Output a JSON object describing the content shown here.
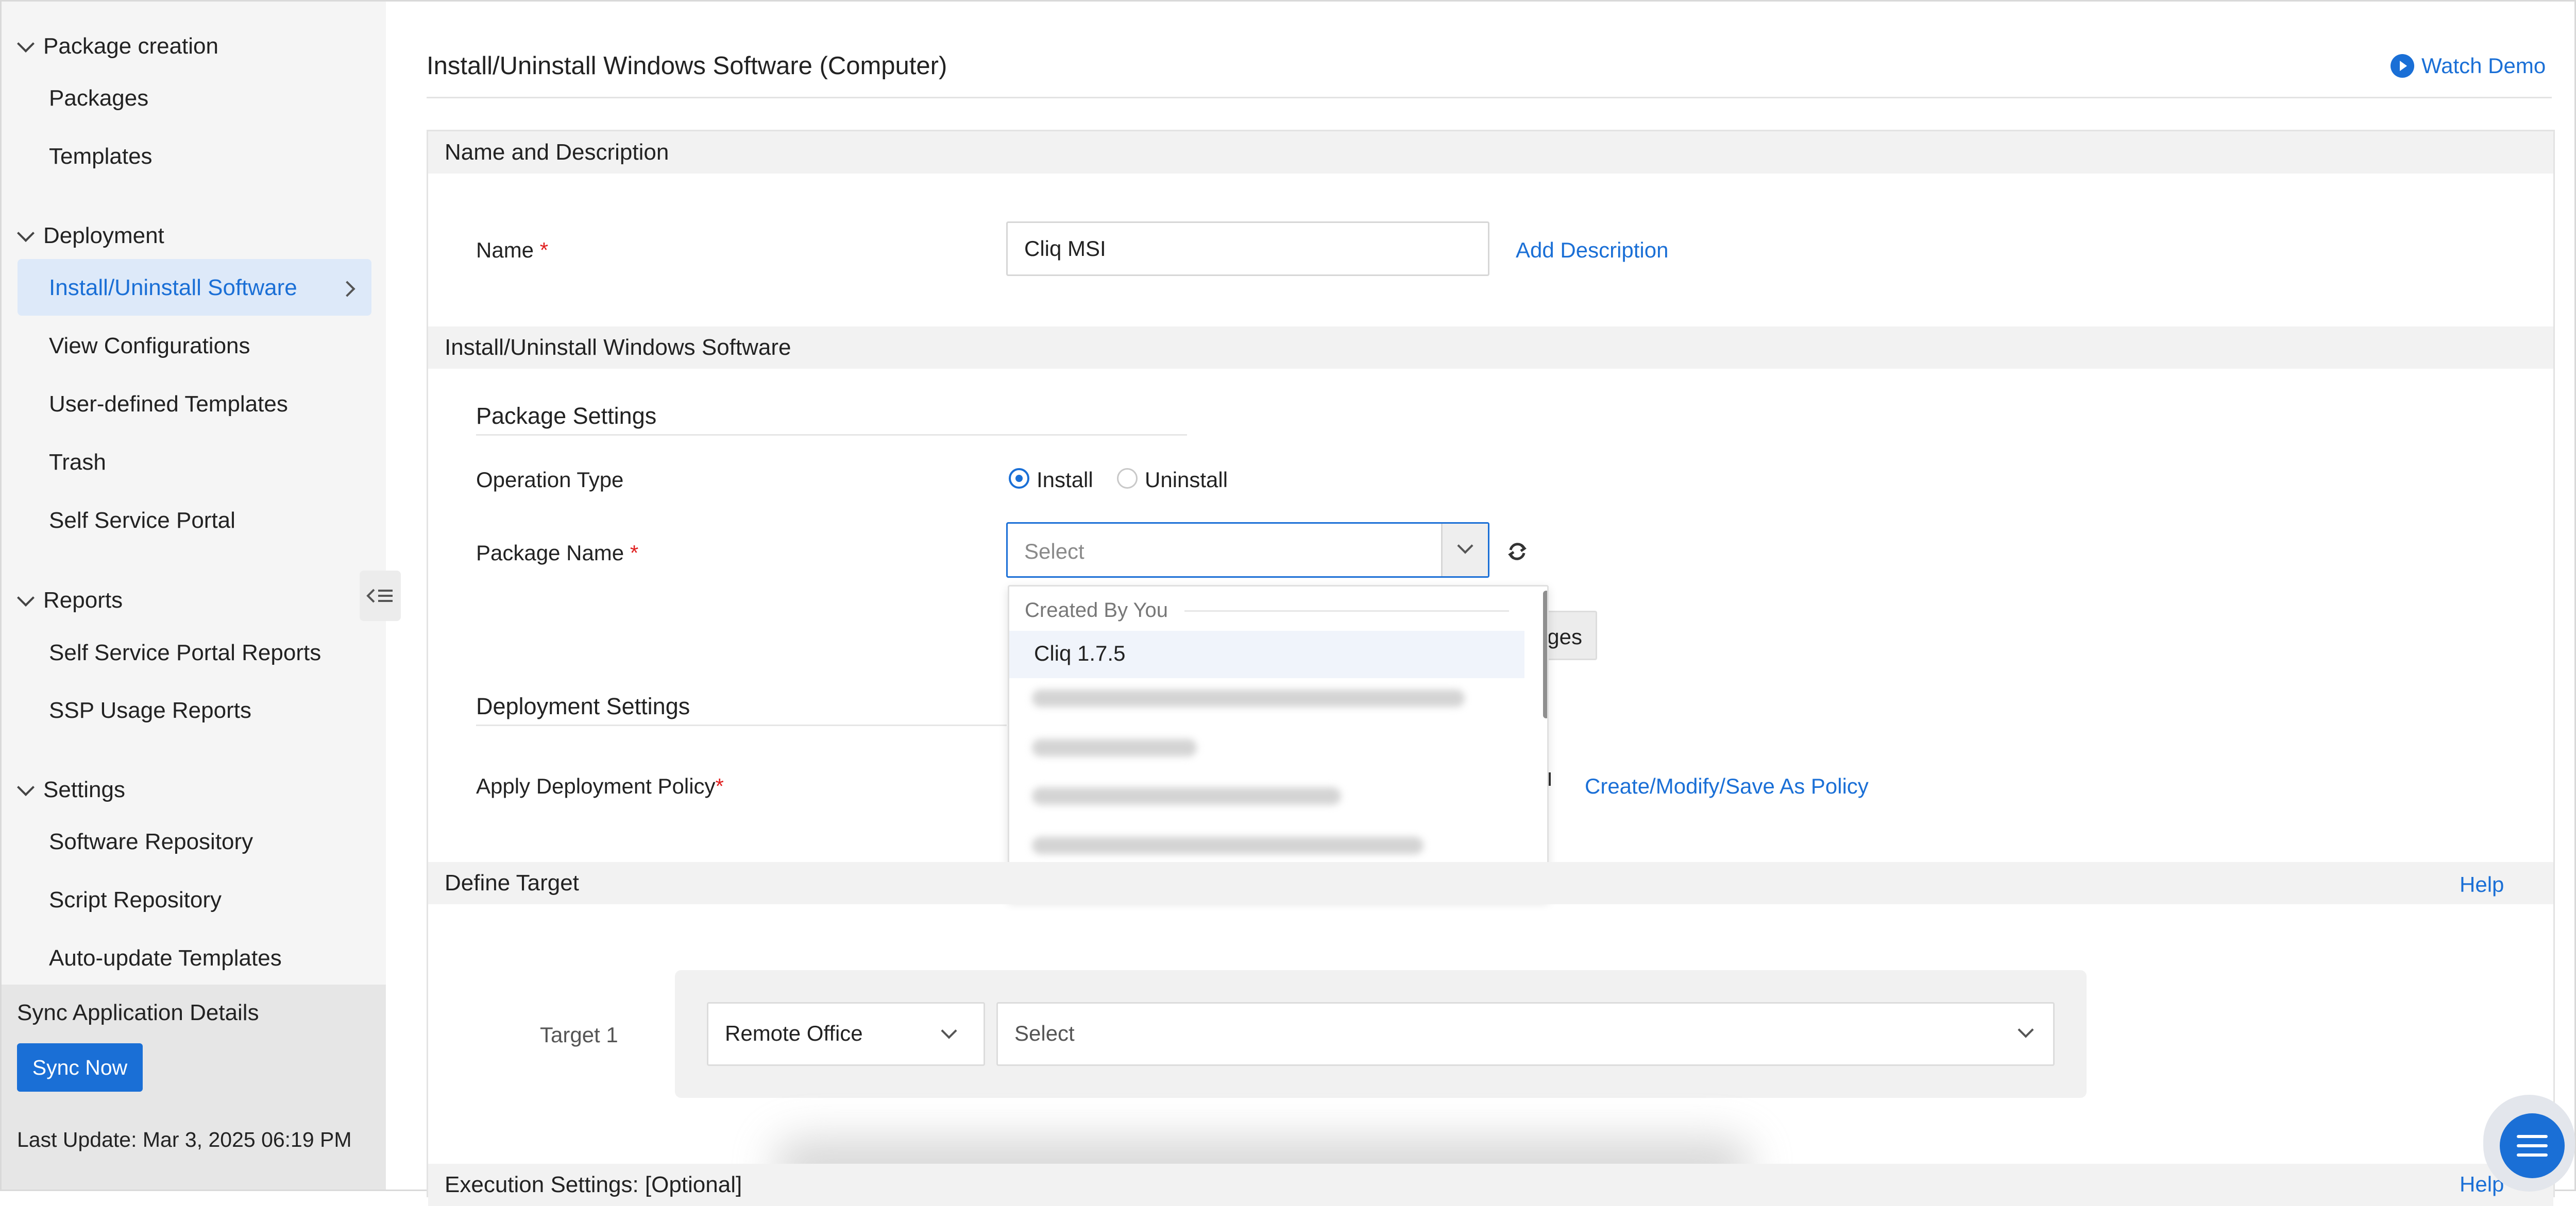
{
  "sidebar": {
    "sections": [
      {
        "title": "Package creation",
        "items": [
          "Packages",
          "Templates"
        ]
      },
      {
        "title": "Deployment",
        "items": [
          "Install/Uninstall Software",
          "View Configurations",
          "User-defined Templates",
          "Trash",
          "Self Service Portal"
        ]
      },
      {
        "title": "Reports",
        "items": [
          "Self Service Portal Reports",
          "SSP Usage Reports"
        ]
      },
      {
        "title": "Settings",
        "items": [
          "Software Repository",
          "Script Repository",
          "Auto-update Templates"
        ]
      }
    ],
    "active_item": "Install/Uninstall Software",
    "sync": {
      "title": "Sync Application Details",
      "button": "Sync Now",
      "last_update": "Last Update: Mar 3, 2025 06:19 PM"
    }
  },
  "page": {
    "title": "Install/Uninstall Windows Software (Computer)",
    "watch_demo": "Watch Demo"
  },
  "name_section": {
    "header": "Name and Description",
    "name_label": "Name",
    "required_mark": "*",
    "name_value": "Cliq MSI",
    "add_description": "Add Description"
  },
  "software_section": {
    "header": "Install/Uninstall Windows Software",
    "package_settings": "Package Settings",
    "operation_type_label": "Operation Type",
    "operation_options": [
      "Install",
      "Uninstall"
    ],
    "operation_selected": "Install",
    "package_name_label": "Package Name",
    "package_placeholder": "Select",
    "hidden_button_fragment": "ges",
    "dropdown": {
      "group": "Created By You",
      "options": [
        "Cliq 1.7.5"
      ],
      "highlighted": "Cliq 1.7.5"
    },
    "deployment_settings": "Deployment Settings",
    "apply_policy_label": "Apply Deployment Policy",
    "policy_link": "Create/Modify/Save As Policy"
  },
  "target_section": {
    "header": "Define Target",
    "help": "Help",
    "target_label": "Target 1",
    "target_type": "Remote Office",
    "target_value_placeholder": "Select"
  },
  "execution_section": {
    "header": "Execution Settings: [Optional]",
    "help": "Help"
  },
  "colors": {
    "accent": "#1a6fd6",
    "required": "#e02020",
    "sidebar_bg": "#f5f5f5",
    "active_bg": "#dde9f9"
  },
  "icons": [
    "chevron-down-icon",
    "chevron-right-icon",
    "collapse-sidebar-icon",
    "play-icon",
    "refresh-icon",
    "menu-icon"
  ]
}
